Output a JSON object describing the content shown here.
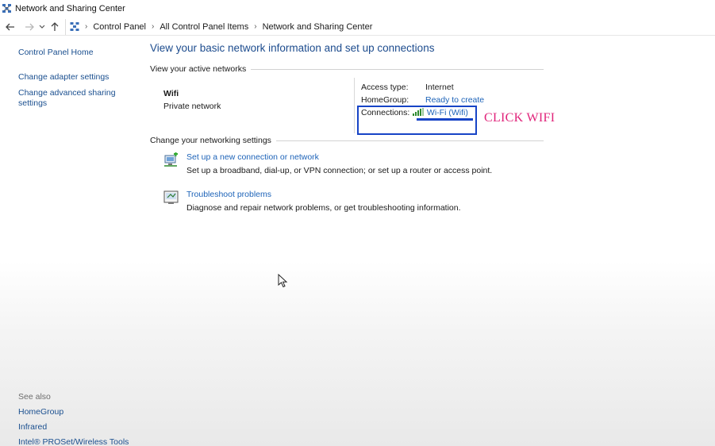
{
  "window": {
    "title": "Network and Sharing Center"
  },
  "address": {
    "crumbs": [
      "Control Panel",
      "All Control Panel Items",
      "Network and Sharing Center"
    ]
  },
  "sidebar": {
    "items": [
      {
        "label": "Control Panel Home"
      },
      {
        "label": "Change adapter settings"
      },
      {
        "label": "Change advanced sharing settings"
      }
    ],
    "see_also_header": "See also",
    "see_also": [
      {
        "label": "HomeGroup"
      },
      {
        "label": "Infrared"
      },
      {
        "label": "Intel® PROSet/Wireless Tools"
      }
    ]
  },
  "main": {
    "title": "View your basic network information and set up connections",
    "active_networks_header": "View your active networks",
    "network": {
      "name": "Wifi",
      "type": "Private network",
      "access_type_label": "Access type:",
      "access_type_value": "Internet",
      "homegroup_label": "HomeGroup:",
      "homegroup_value": "Ready to create",
      "connections_label": "Connections:",
      "connections_value": "Wi-Fi (Wifi)"
    },
    "settings_header": "Change your networking settings",
    "tasks": [
      {
        "link": "Set up a new connection or network",
        "description": "Set up a broadband, dial-up, or VPN connection; or set up a router or access point.",
        "icon": "network-setup-icon"
      },
      {
        "link": "Troubleshoot problems",
        "description": "Diagnose and repair network problems, or get troubleshooting information.",
        "icon": "troubleshoot-icon"
      }
    ]
  },
  "annotation": {
    "text": "CLICK WIFI",
    "color": "#e0237a",
    "box_color": "#1744c6"
  }
}
